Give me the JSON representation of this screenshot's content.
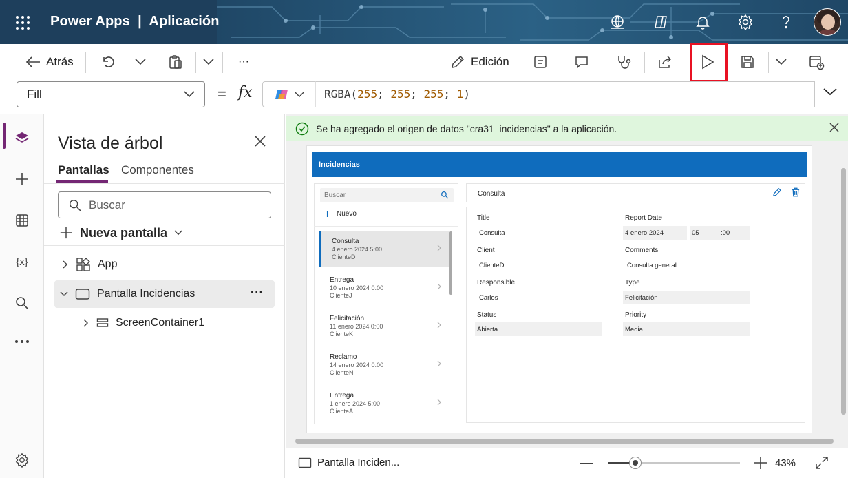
{
  "header": {
    "app_title": "Power Apps  |  Aplicación",
    "icons": [
      "waffle-icon",
      "environment-icon",
      "copilot-icon",
      "notifications-icon",
      "settings-icon",
      "help-icon",
      "avatar"
    ]
  },
  "toolbar": {
    "back_label": "Atrás",
    "more_label": "···",
    "edit_label": "Edición"
  },
  "formula": {
    "property": "Fill",
    "equals": "=",
    "fx": "fx",
    "expression_fn": "RGBA(",
    "expression_args": [
      "255",
      "255",
      "255",
      "1"
    ],
    "expression_sep": "; ",
    "expression_close": ")"
  },
  "tree": {
    "title": "Vista de árbol",
    "tabs": [
      "Pantallas",
      "Componentes"
    ],
    "search_placeholder": "Buscar",
    "new_screen": "Nueva pantalla",
    "items": [
      {
        "label": "App"
      },
      {
        "label": "Pantalla Incidencias"
      },
      {
        "label": "ScreenContainer1"
      }
    ],
    "row_more": "···"
  },
  "notification": {
    "text": "Se ha agregado el origen de datos \"cra31_incidencias\" a la aplicación."
  },
  "app_preview": {
    "header_title": "Incidencias",
    "search_placeholder": "Buscar",
    "new_label": "Nuevo",
    "list": [
      {
        "title": "Consulta",
        "date": "4 enero 2024 5:00",
        "client": "ClienteD",
        "selected": true
      },
      {
        "title": "Entrega",
        "date": "10 enero 2024 0:00",
        "client": "ClienteJ",
        "selected": false
      },
      {
        "title": "Felicitación",
        "date": "11 enero 2024 0:00",
        "client": "ClienteK",
        "selected": false
      },
      {
        "title": "Reclamo",
        "date": "14 enero 2024 0:00",
        "client": "ClienteN",
        "selected": false
      },
      {
        "title": "Entrega",
        "date": "1 enero 2024 5:00",
        "client": "ClienteA",
        "selected": false
      }
    ],
    "detail_title": "Consulta",
    "fields": {
      "title_label": "Title",
      "title_value": "Consulta",
      "report_date_label": "Report Date",
      "report_date_value": "4 enero 2024",
      "report_hour": "05",
      "report_minute": ":00",
      "client_label": "Client",
      "client_value": "ClienteD",
      "comments_label": "Comments",
      "comments_value": "Consulta general",
      "responsible_label": "Responsible",
      "responsible_value": "Carlos",
      "type_label": "Type",
      "type_value": "Felicitación",
      "status_label": "Status",
      "status_value": "Abierta",
      "priority_label": "Priority",
      "priority_value": "Media"
    }
  },
  "statusbar": {
    "screen_label": "Pantalla Inciden...",
    "zoom_percent": "43%",
    "zoom_level": 0.43
  },
  "colors": {
    "header_bg": "#1e3f5c",
    "accent": "#742774",
    "app_header_blue": "#0f6cbd",
    "notification_bg": "#dff6dd",
    "highlight_red": "#e81123"
  }
}
